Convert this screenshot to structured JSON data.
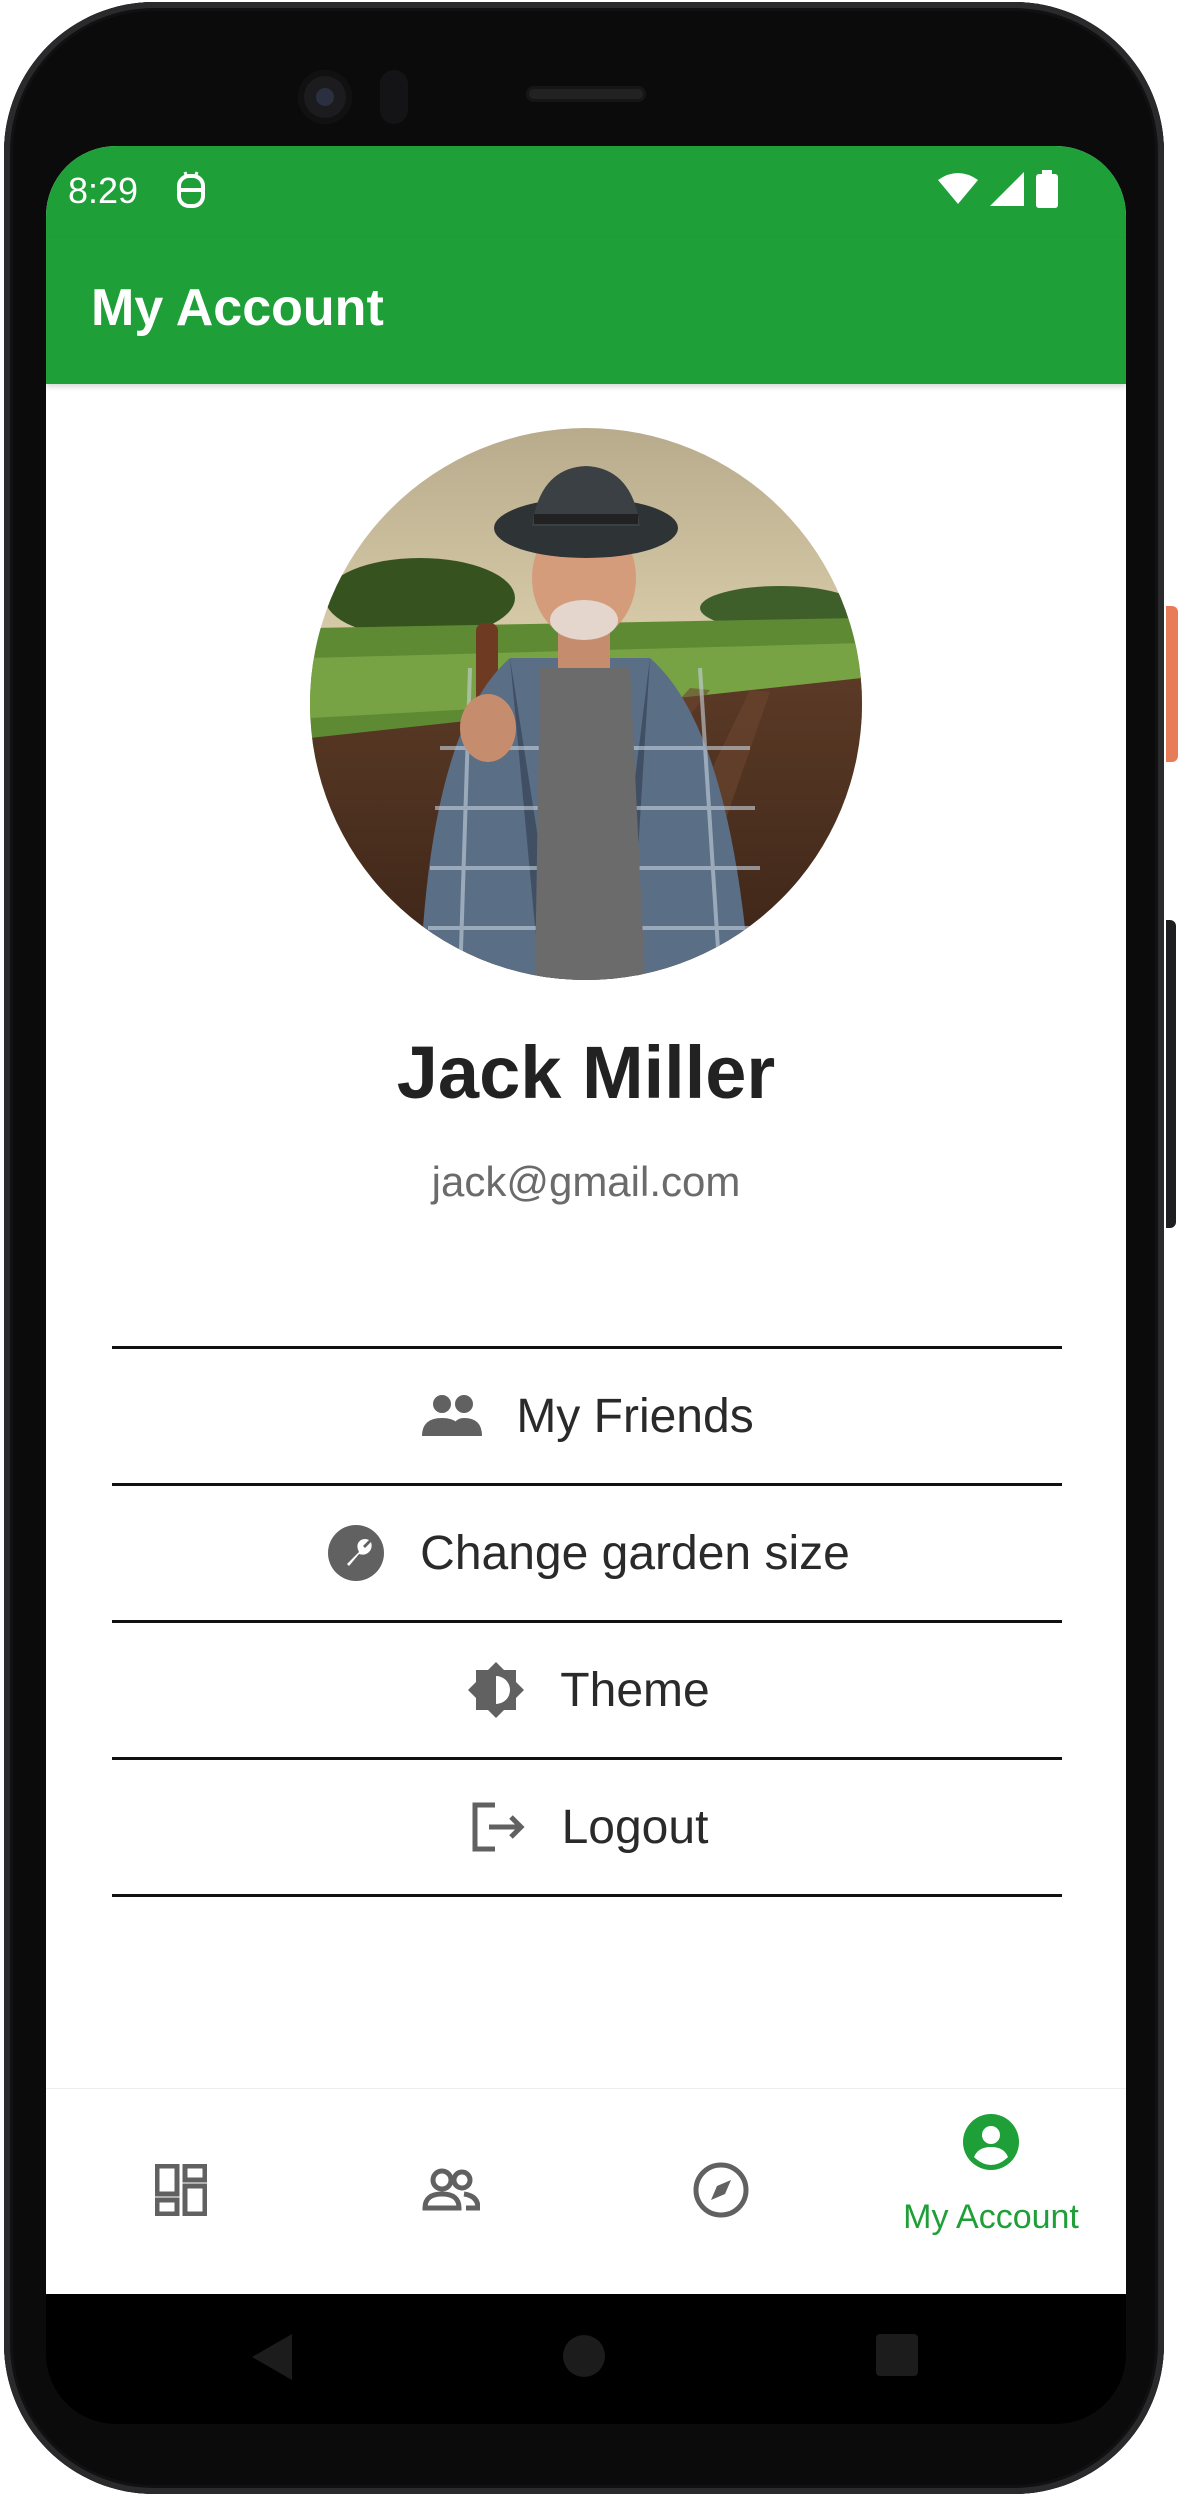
{
  "status_bar": {
    "time": "8:29"
  },
  "app_bar": {
    "title": "My Account"
  },
  "profile": {
    "name": "Jack Miller",
    "email": "jack@gmail.com",
    "avatar_icon": "farmer-photo"
  },
  "menu": {
    "items": [
      {
        "label": "My Friends",
        "icon": "people-icon"
      },
      {
        "label": "Change garden size",
        "icon": "wrench-icon"
      },
      {
        "label": "Theme",
        "icon": "brightness-icon"
      },
      {
        "label": "Logout",
        "icon": "logout-icon"
      }
    ]
  },
  "bottom_nav": {
    "items": [
      {
        "icon": "dashboard-icon",
        "label": ""
      },
      {
        "icon": "people-icon",
        "label": ""
      },
      {
        "icon": "compass-icon",
        "label": ""
      },
      {
        "icon": "account-circle-icon",
        "label": "My Account",
        "active": true
      }
    ]
  },
  "colors": {
    "primary": "#1e9f38",
    "text_dark": "#222222",
    "text_muted": "#6b6b6b",
    "icon_grey": "#616161"
  }
}
